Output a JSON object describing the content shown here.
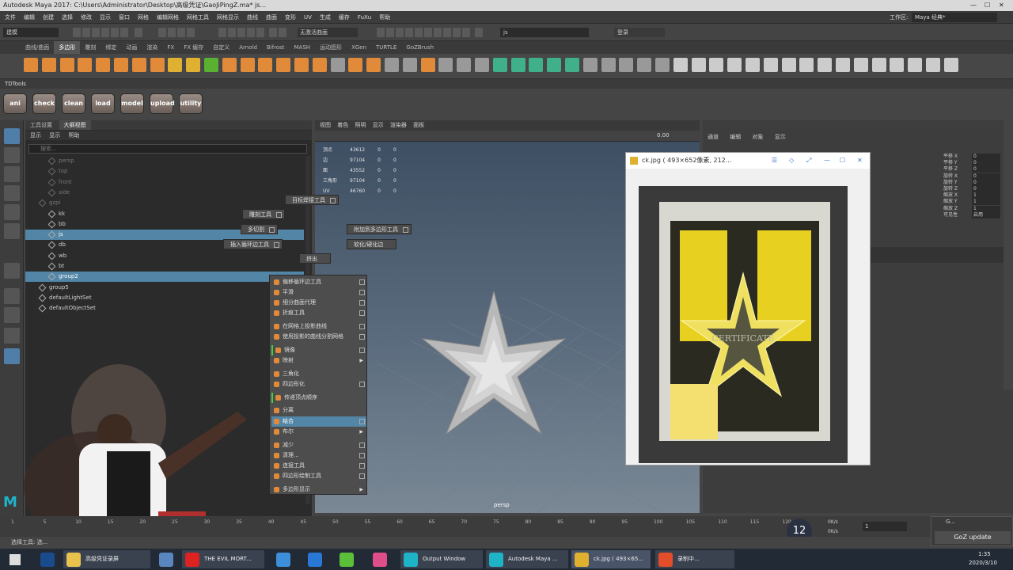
{
  "window": {
    "title": "Autodesk Maya 2017: C:\\Users\\Administrator\\Desktop\\高级凭证\\GaoJiPingZ.ma*    js..."
  },
  "menubar": {
    "items": [
      "文件",
      "编辑",
      "创建",
      "选择",
      "修改",
      "显示",
      "窗口",
      "网格",
      "编辑网格",
      "网格工具",
      "网格显示",
      "曲线",
      "曲面",
      "变形",
      "UV",
      "生成",
      "缓存",
      "FuXu",
      "帮助"
    ],
    "workspace_label": "工作区:",
    "workspace_value": "Maya 经典*"
  },
  "statusline": {
    "mode": "建模",
    "no_active_surface": "无激活曲面",
    "search_value": "js",
    "login": "登录"
  },
  "shelf_tabs": [
    "曲线/曲面",
    "多边形",
    "雕刻",
    "绑定",
    "动画",
    "渲染",
    "FX",
    "FX 缓存",
    "自定义",
    "Arnold",
    "Bifrost",
    "MASH",
    "运动图形",
    "XGen",
    "TURTLE",
    "GoZBrush"
  ],
  "shelf_tab_active": "多边形",
  "td_tools": {
    "title": "TDTools",
    "buttons": [
      "ani",
      "check",
      "clean",
      "load",
      "model",
      "upload",
      "utility"
    ]
  },
  "outliner": {
    "tabs": [
      "工具设置",
      "大纲视图"
    ],
    "menu": [
      "显示",
      "显示",
      "帮助"
    ],
    "search_placeholder": "搜索...",
    "items": [
      {
        "label": "persp",
        "indent": 1,
        "dim": true
      },
      {
        "label": "top",
        "indent": 1,
        "dim": true
      },
      {
        "label": "front",
        "indent": 1,
        "dim": true
      },
      {
        "label": "side",
        "indent": 1,
        "dim": true
      },
      {
        "label": "gzpi",
        "indent": 0,
        "dim": true
      },
      {
        "label": "kk",
        "indent": 1
      },
      {
        "label": "bb",
        "indent": 1
      },
      {
        "label": "js",
        "indent": 1,
        "selected": true
      },
      {
        "label": "db",
        "indent": 1
      },
      {
        "label": "wb",
        "indent": 1
      },
      {
        "label": "bt",
        "indent": 1
      },
      {
        "label": "group2",
        "indent": 1,
        "selected": true
      },
      {
        "label": "group5",
        "indent": 0
      },
      {
        "label": "defaultLightSet",
        "indent": 0
      },
      {
        "label": "defaultObjectSet",
        "indent": 0
      }
    ]
  },
  "viewport": {
    "menu": [
      "视图",
      "着色",
      "照明",
      "显示",
      "渲染器",
      "面板"
    ],
    "hud_value": "0.00",
    "label": "persp",
    "stats": [
      [
        "顶点",
        "43612",
        "0",
        "0"
      ],
      [
        "边",
        "97104",
        "0",
        "0"
      ],
      [
        "面",
        "43552",
        "0",
        "0"
      ],
      [
        "三角形",
        "97104",
        "0",
        "0"
      ],
      [
        "UV",
        "46760",
        "0",
        "0"
      ]
    ]
  },
  "radial_menu": [
    "目标焊接工具",
    "雕刻工具",
    "多切割",
    "附加到多边形工具",
    "插入循环边工具",
    "软化/硬化边",
    "挤出"
  ],
  "context_menu": [
    {
      "label": "偏移循环边工具",
      "box": true
    },
    {
      "label": "平滑",
      "box": true
    },
    {
      "label": "细分曲面代理",
      "box": true
    },
    {
      "label": "折痕工具",
      "box": true
    },
    {
      "label": "在网格上投影曲线",
      "box": true
    },
    {
      "label": "使用投影的曲线分割网格",
      "box": true
    },
    {
      "label": "镜像",
      "box": true,
      "green": true
    },
    {
      "label": "映射",
      "arrow": true
    },
    {
      "label": "三角化",
      "box": false
    },
    {
      "label": "四边形化",
      "box": true
    },
    {
      "label": "传递顶点顺序",
      "green": true
    },
    {
      "label": "分离",
      "box": false
    },
    {
      "label": "结合",
      "box": true,
      "highlight": true
    },
    {
      "label": "布尔",
      "arrow": true
    },
    {
      "label": "减少",
      "box": true
    },
    {
      "label": "清理...",
      "box": true
    },
    {
      "label": "连接工具",
      "box": true
    },
    {
      "label": "四边形绘制工具",
      "box": true
    },
    {
      "label": "多边形显示",
      "arrow": true
    }
  ],
  "channel_box": {
    "menu": [
      "通道",
      "编辑",
      "对象",
      "显示"
    ],
    "attrs": [
      [
        "平移 X",
        "0"
      ],
      [
        "平移 Y",
        "0"
      ],
      [
        "平移 Z",
        "0"
      ],
      [
        "旋转 X",
        "0"
      ],
      [
        "旋转 Y",
        "0"
      ],
      [
        "旋转 Z",
        "0"
      ],
      [
        "缩放 X",
        "1"
      ],
      [
        "缩放 Y",
        "1"
      ],
      [
        "缩放 Z",
        "1"
      ],
      [
        "可见性",
        "启用"
      ]
    ]
  },
  "image_viewer": {
    "title": "ck.jpg ( 493×652像素, 212...",
    "card_text": "CERTIFICATE"
  },
  "timeline": {
    "ticks": [
      "1",
      "5",
      "10",
      "15",
      "20",
      "25",
      "30",
      "35",
      "40",
      "45",
      "50",
      "55",
      "60",
      "65",
      "70",
      "75",
      "80",
      "85",
      "90",
      "95",
      "100",
      "105",
      "110",
      "115",
      "120"
    ],
    "current_frame": "1",
    "fps_badge": "12",
    "rate1": "0K/s",
    "rate2": "0K/s"
  },
  "goz": {
    "title": "G...",
    "button": "GoZ update"
  },
  "taskbar": {
    "items": [
      "高级凭证录屏",
      "THE EVIL MORT...",
      "Output Window",
      "Autodesk Maya ...",
      "ck.jpg ( 493×65...",
      "录制中..."
    ],
    "time": "1:35",
    "date": "2020/3/10"
  },
  "help_line": "选择工具: 选..."
}
